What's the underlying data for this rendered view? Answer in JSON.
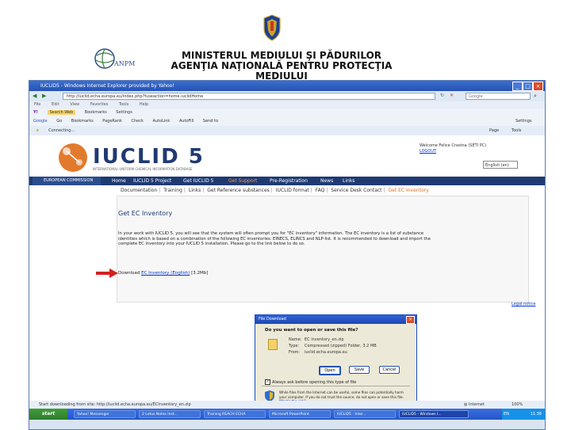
{
  "slide": {
    "org_line1": "MINISTERUL MEDIULUI ŞI PĂDURILOR",
    "org_line2": "AGENŢIA NAŢIONALĂ PENTRU PROTECŢIA MEDIULUI",
    "anpm_logo_text": "ANPM"
  },
  "browser": {
    "title": "IUCLID5 - Windows Internet Explorer provided by Yahoo!",
    "url": "http://iuclid.echa.europa.eu/index.php?fuseaction=home.iuclidHome",
    "search_placeholder": "Google",
    "menu": [
      "File",
      "Edit",
      "View",
      "Favorites",
      "Tools",
      "Help"
    ],
    "toolbar1": [
      "Search Web",
      "Bookmarks",
      "Settings"
    ],
    "toolbar2": [
      "Google",
      "Go",
      "Bookmarks",
      "PageRank",
      "Check",
      "AutoLink",
      "AutoFill",
      "Send to",
      "Settings"
    ],
    "tab_label": "Connecting...",
    "tab_tools": [
      "Page",
      "Tools"
    ]
  },
  "site": {
    "logo_text": "IUCLID 5",
    "logo_sub": "INTERNATIONAL UNIFORM CHEMICAL INFORMATION DATABASE",
    "welcome": "Welcome Felice Crastna (SETI PC)",
    "logout": "LOGOUT",
    "language": "English (en)",
    "ec_label": "EUROPEAN COMMISSION",
    "nav": [
      "Home",
      "IUCLID 5 Project",
      "Get IUCLID 5",
      "Get Support",
      "Pre-Registration",
      "News",
      "Links"
    ],
    "subnav": [
      "Documentation",
      "Training",
      "Links",
      "Get Reference substances",
      "IUCLID format",
      "FAQ",
      "Service Desk Contact"
    ],
    "subnav_current": "Get EC Inventory",
    "heading": "Get EC Inventory",
    "paragraph": "In your work with IUCLID 5, you will see that the system will often prompt you for \"EC inventory\" information. The EC inventory is a list of substance identities which is based on a combination of the following EC inventories: EINECS, ELINCS and NLP-list. It is recommended to download and import the complete EC inventory into your IUCLID 5 installation. Please go to the link below to do so.",
    "download_prefix": "Download",
    "download_link": "EC Inventory (English)",
    "download_size": "[3.2Mb]",
    "legal_notice": "Legal notice"
  },
  "dialog": {
    "title": "File Download",
    "question": "Do you want to open or save this file?",
    "name_label": "Name:",
    "name_value": "EC inventory_en.zip",
    "type_label": "Type:",
    "type_value": "Compressed (zipped) Folder, 3.2 MB",
    "from_label": "From:",
    "from_value": "iuclid.echa.europa.eu",
    "open_btn": "Open",
    "save_btn": "Save",
    "cancel_btn": "Cancel",
    "checkbox_label": "Always ask before opening this type of file",
    "warning": "While files from the Internet can be useful, some files can potentially harm your computer. If you do not trust the source, do not open or save this file.",
    "risk_link": "What's the risk?"
  },
  "status": {
    "text": "Start downloading from site: http://iuclid.echa.europa.eu/ECInventory_en.zip",
    "zone": "Internet",
    "zoom": "100%"
  },
  "taskbar": {
    "start": "start",
    "tasks": [
      "Yahoo! Messenger",
      "2 Lotus Notes Inst...",
      "Training REACH ECHA",
      "Microsoft PowerPoint",
      "IUCLID5 - Inter...",
      "IUCLID5 - Windows I..."
    ],
    "lang": "EN",
    "clock": "11:38"
  }
}
